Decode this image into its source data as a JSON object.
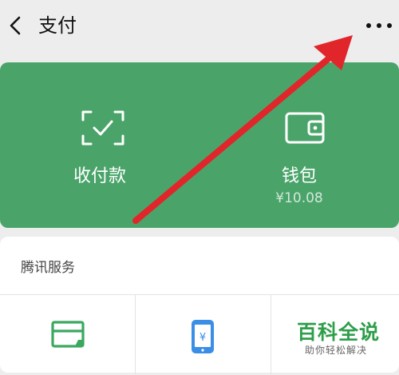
{
  "header": {
    "title": "支付",
    "back_icon": "back-chevron-icon",
    "more_icon": "more-dots-icon"
  },
  "payment_card": {
    "background": "#4aa46a",
    "receive_pay": {
      "label": "收付款",
      "icon": "scan-frame-icon"
    },
    "wallet": {
      "label": "钱包",
      "balance": "¥10.08",
      "icon": "wallet-icon"
    }
  },
  "tencent_services": {
    "title": "腾讯服务",
    "items": [
      {
        "icon": "card-icon",
        "icon_color": "#3ba85f"
      },
      {
        "icon": "phone-yuan-icon",
        "icon_color": "#3b8ee6"
      }
    ]
  },
  "annotation": {
    "icon": "red-arrow-icon",
    "color": "#e0262b"
  },
  "watermark": {
    "title": "百科全说",
    "subtitle": "助你轻松解决"
  }
}
